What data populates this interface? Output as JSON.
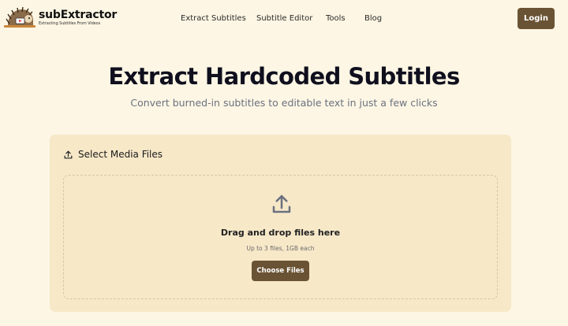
{
  "brand": {
    "name": "subExtractor",
    "tagline": "Extracting Subtitles From Videos"
  },
  "nav": {
    "items": [
      {
        "label": "Extract Subtitles"
      },
      {
        "label": "Subtitle Editor"
      },
      {
        "label": "Tools"
      },
      {
        "label": "Blog"
      }
    ],
    "login_label": "Login"
  },
  "hero": {
    "title": "Extract Hardcoded Subtitles",
    "subtitle": "Convert burned-in subtitles to editable text in just a few clicks"
  },
  "upload": {
    "header_icon": "upload-icon",
    "title": "Select Media Files",
    "dropzone": {
      "icon": "upload-icon",
      "title": "Drag and drop files here",
      "hint": "Up to 3 files, 1GB each",
      "button_label": "Choose Files"
    }
  },
  "colors": {
    "background": "#fdf6e4",
    "card": "#f7e8c8",
    "accent": "#6a5334",
    "muted_text": "#6b7180"
  }
}
